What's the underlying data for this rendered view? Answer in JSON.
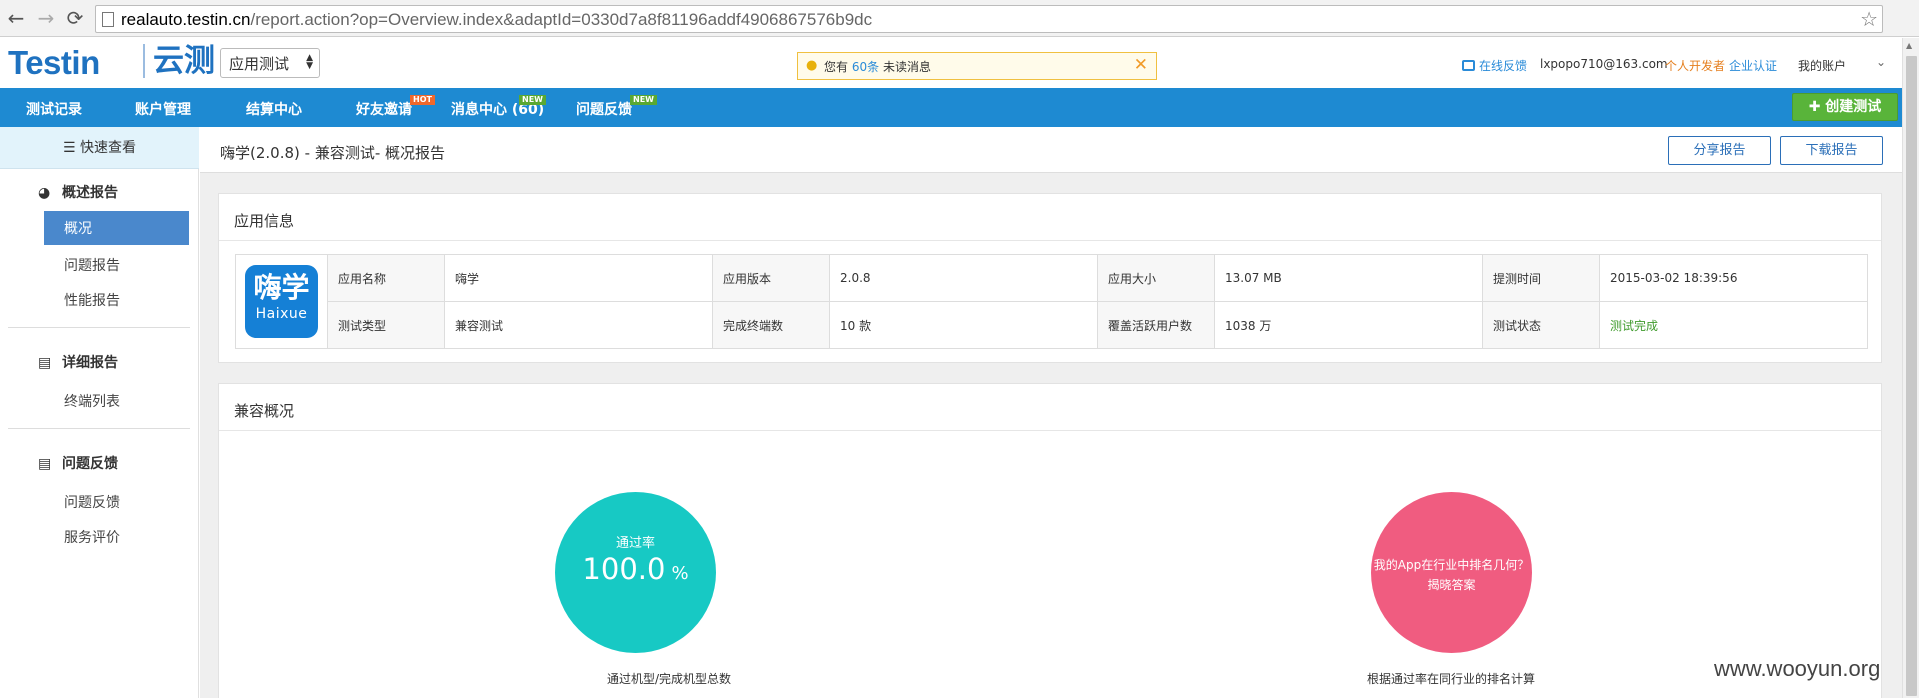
{
  "browser": {
    "url_host": "realauto.testin.cn",
    "url_path": "/report.action?op=Overview.index&adaptId=0330d7a8f81196addf4906867576b9dc"
  },
  "header": {
    "logo_text": "Testin",
    "logo_cn": "云测",
    "app_select_value": "应用测试",
    "notice_prefix": "您有",
    "notice_count": "60条",
    "notice_suffix": "未读消息",
    "feedback_label": "在线反馈",
    "email": "lxpopo710@163.com",
    "dev_label": "个人开发者",
    "cert_label": "企业认证",
    "account_label": "我的账户"
  },
  "topnav": {
    "items": [
      {
        "label": "测试记录"
      },
      {
        "label": "账户管理"
      },
      {
        "label": "结算中心"
      },
      {
        "label": "好友邀请",
        "badge": "HOT"
      },
      {
        "label": "消息中心 (60)",
        "badge": "NEW"
      },
      {
        "label": "问题反馈",
        "badge": "NEW"
      }
    ],
    "create_label": "创建测试"
  },
  "sidebar": {
    "quick_view": "快速查看",
    "sections": [
      {
        "title": "概述报告",
        "items": [
          "概况",
          "问题报告",
          "性能报告"
        ]
      },
      {
        "title": "详细报告",
        "items": [
          "终端列表"
        ]
      },
      {
        "title": "问题反馈",
        "items": [
          "问题反馈",
          "服务评价"
        ]
      }
    ]
  },
  "main": {
    "report_title": "嗨学(2.0.8) - 兼容测试- 概况报告",
    "share_label": "分享报告",
    "download_label": "下载报告",
    "app_info": {
      "title": "应用信息",
      "icon_cn": "嗨学",
      "icon_en": "Haixue",
      "rows": [
        [
          {
            "label": "应用名称",
            "value": "嗨学"
          },
          {
            "label": "应用版本",
            "value": "2.0.8"
          },
          {
            "label": "应用大小",
            "value": "13.07 MB"
          },
          {
            "label": "提测时间",
            "value": "2015-03-02 18:39:56"
          }
        ],
        [
          {
            "label": "测试类型",
            "value": "兼容测试"
          },
          {
            "label": "完成终端数",
            "value": "10 款"
          },
          {
            "label": "覆盖活跃用户数",
            "value": "1038 万"
          },
          {
            "label": "测试状态",
            "value": "测试完成"
          }
        ]
      ]
    },
    "compat": {
      "title": "兼容概况",
      "pass_label": "通过率",
      "pass_value": "100.0",
      "pass_unit": "%",
      "pass_caption": "通过机型/完成机型总数",
      "rank_question": "我的App在行业中排名几何？",
      "rank_answer": "揭晓答案",
      "rank_caption": "根据通过率在同行业的排名计算"
    }
  },
  "watermark": "www.wooyun.org",
  "colors": {
    "nav_blue": "#1e8ad2",
    "create_green": "#59b43a",
    "pass_teal": "#17c9c4",
    "rank_pink": "#f05c80",
    "status_green": "#3f9b2c"
  }
}
